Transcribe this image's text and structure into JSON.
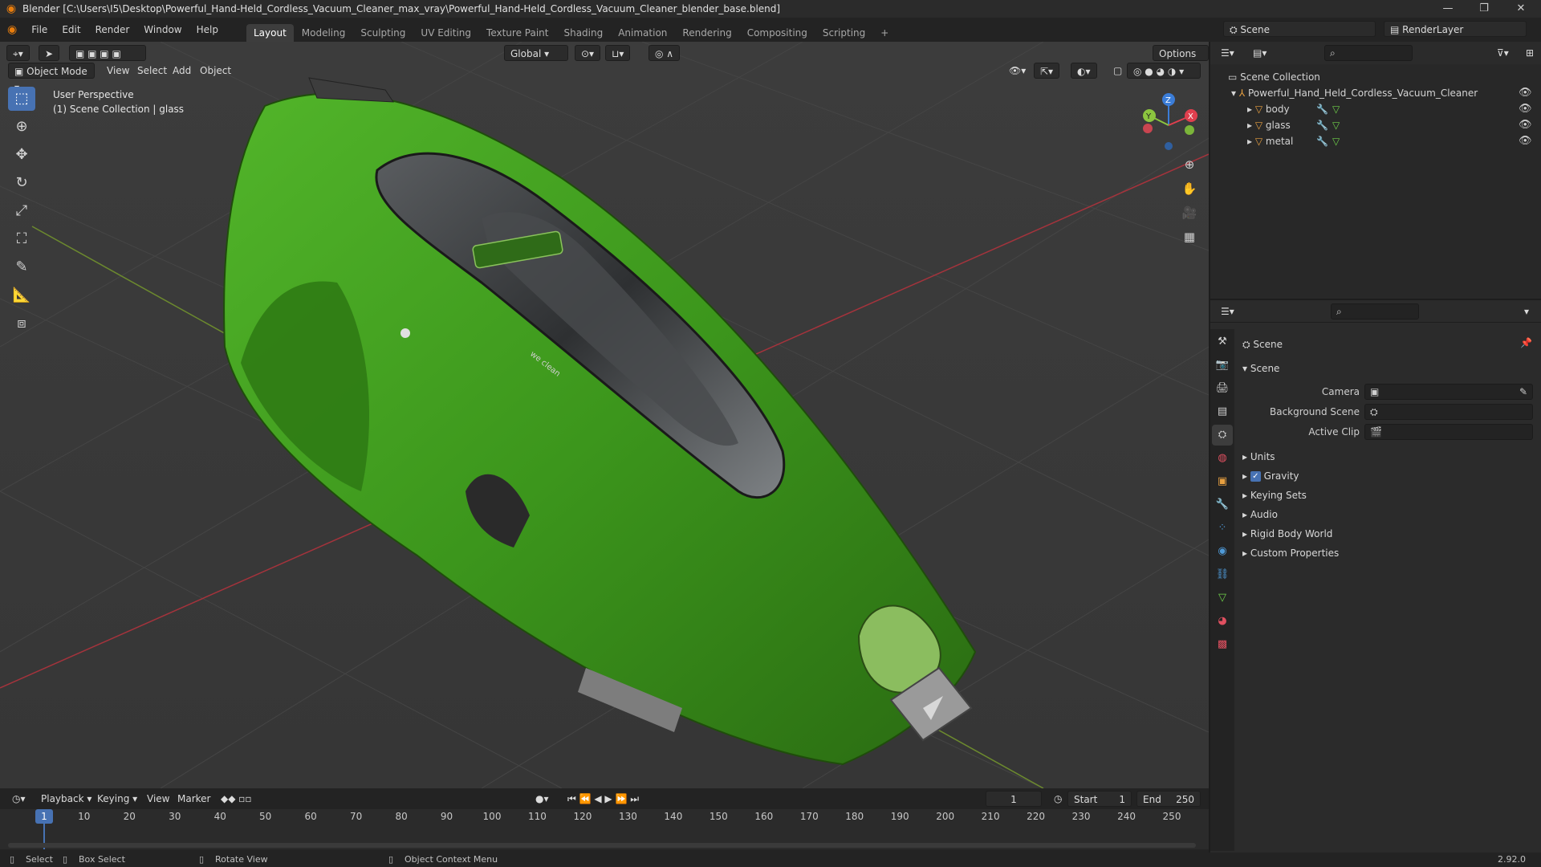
{
  "window": {
    "title": "Blender [C:\\Users\\I5\\Desktop\\Powerful_Hand-Held_Cordless_Vacuum_Cleaner_max_vray\\Powerful_Hand-Held_Cordless_Vacuum_Cleaner_blender_base.blend]",
    "minimize": "—",
    "maximize": "❐",
    "close": "✕"
  },
  "menu": [
    "File",
    "Edit",
    "Render",
    "Window",
    "Help"
  ],
  "workspaces": [
    "Layout",
    "Modeling",
    "Sculpting",
    "UV Editing",
    "Texture Paint",
    "Shading",
    "Animation",
    "Rendering",
    "Compositing",
    "Scripting",
    "+"
  ],
  "active_workspace": "Layout",
  "scene_selector": {
    "label": "Scene"
  },
  "render_layer": {
    "label": "RenderLayer"
  },
  "viewport": {
    "mode": "Object Mode",
    "menus": [
      "View",
      "Select",
      "Add",
      "Object"
    ],
    "transform_orientation": "Global",
    "options": "Options",
    "info_line1": "User Perspective",
    "info_line2": "(1) Scene Collection | glass",
    "gizmo": {
      "x": "X",
      "y": "Y",
      "z": "Z"
    },
    "screen_label": "we clean"
  },
  "timeline": {
    "menus": [
      "Playback",
      "Keying",
      "View",
      "Marker"
    ],
    "current_frame": "1",
    "start_label": "Start",
    "start": "1",
    "end_label": "End",
    "end": "250",
    "ticks": [
      "1",
      "10",
      "20",
      "30",
      "40",
      "50",
      "60",
      "70",
      "80",
      "90",
      "100",
      "110",
      "120",
      "130",
      "140",
      "150",
      "160",
      "170",
      "180",
      "190",
      "200",
      "210",
      "220",
      "230",
      "240",
      "250"
    ]
  },
  "outliner": {
    "root": "Scene Collection",
    "collection": "Powerful_Hand_Held_Cordless_Vacuum_Cleaner",
    "objects": [
      "body",
      "glass",
      "metal"
    ]
  },
  "properties": {
    "header": "Scene",
    "section": "Scene",
    "fields": [
      {
        "label": "Camera",
        "value": ""
      },
      {
        "label": "Background Scene",
        "value": ""
      },
      {
        "label": "Active Clip",
        "value": ""
      }
    ],
    "panels": [
      "Units",
      "Gravity",
      "Keying Sets",
      "Audio",
      "Rigid Body World",
      "Custom Properties"
    ],
    "gravity_checked": true
  },
  "statusbar": {
    "select": "Select",
    "box_select": "Box Select",
    "rotate_view": "Rotate View",
    "context_menu": "Object Context Menu",
    "version": "2.92.0"
  },
  "colors": {
    "accent": "#4772b3",
    "vacuum_green": "#3f9a1e",
    "x_axis": "#e03f4e",
    "y_axis": "#8cc63f",
    "z_axis": "#3b7dd8"
  }
}
